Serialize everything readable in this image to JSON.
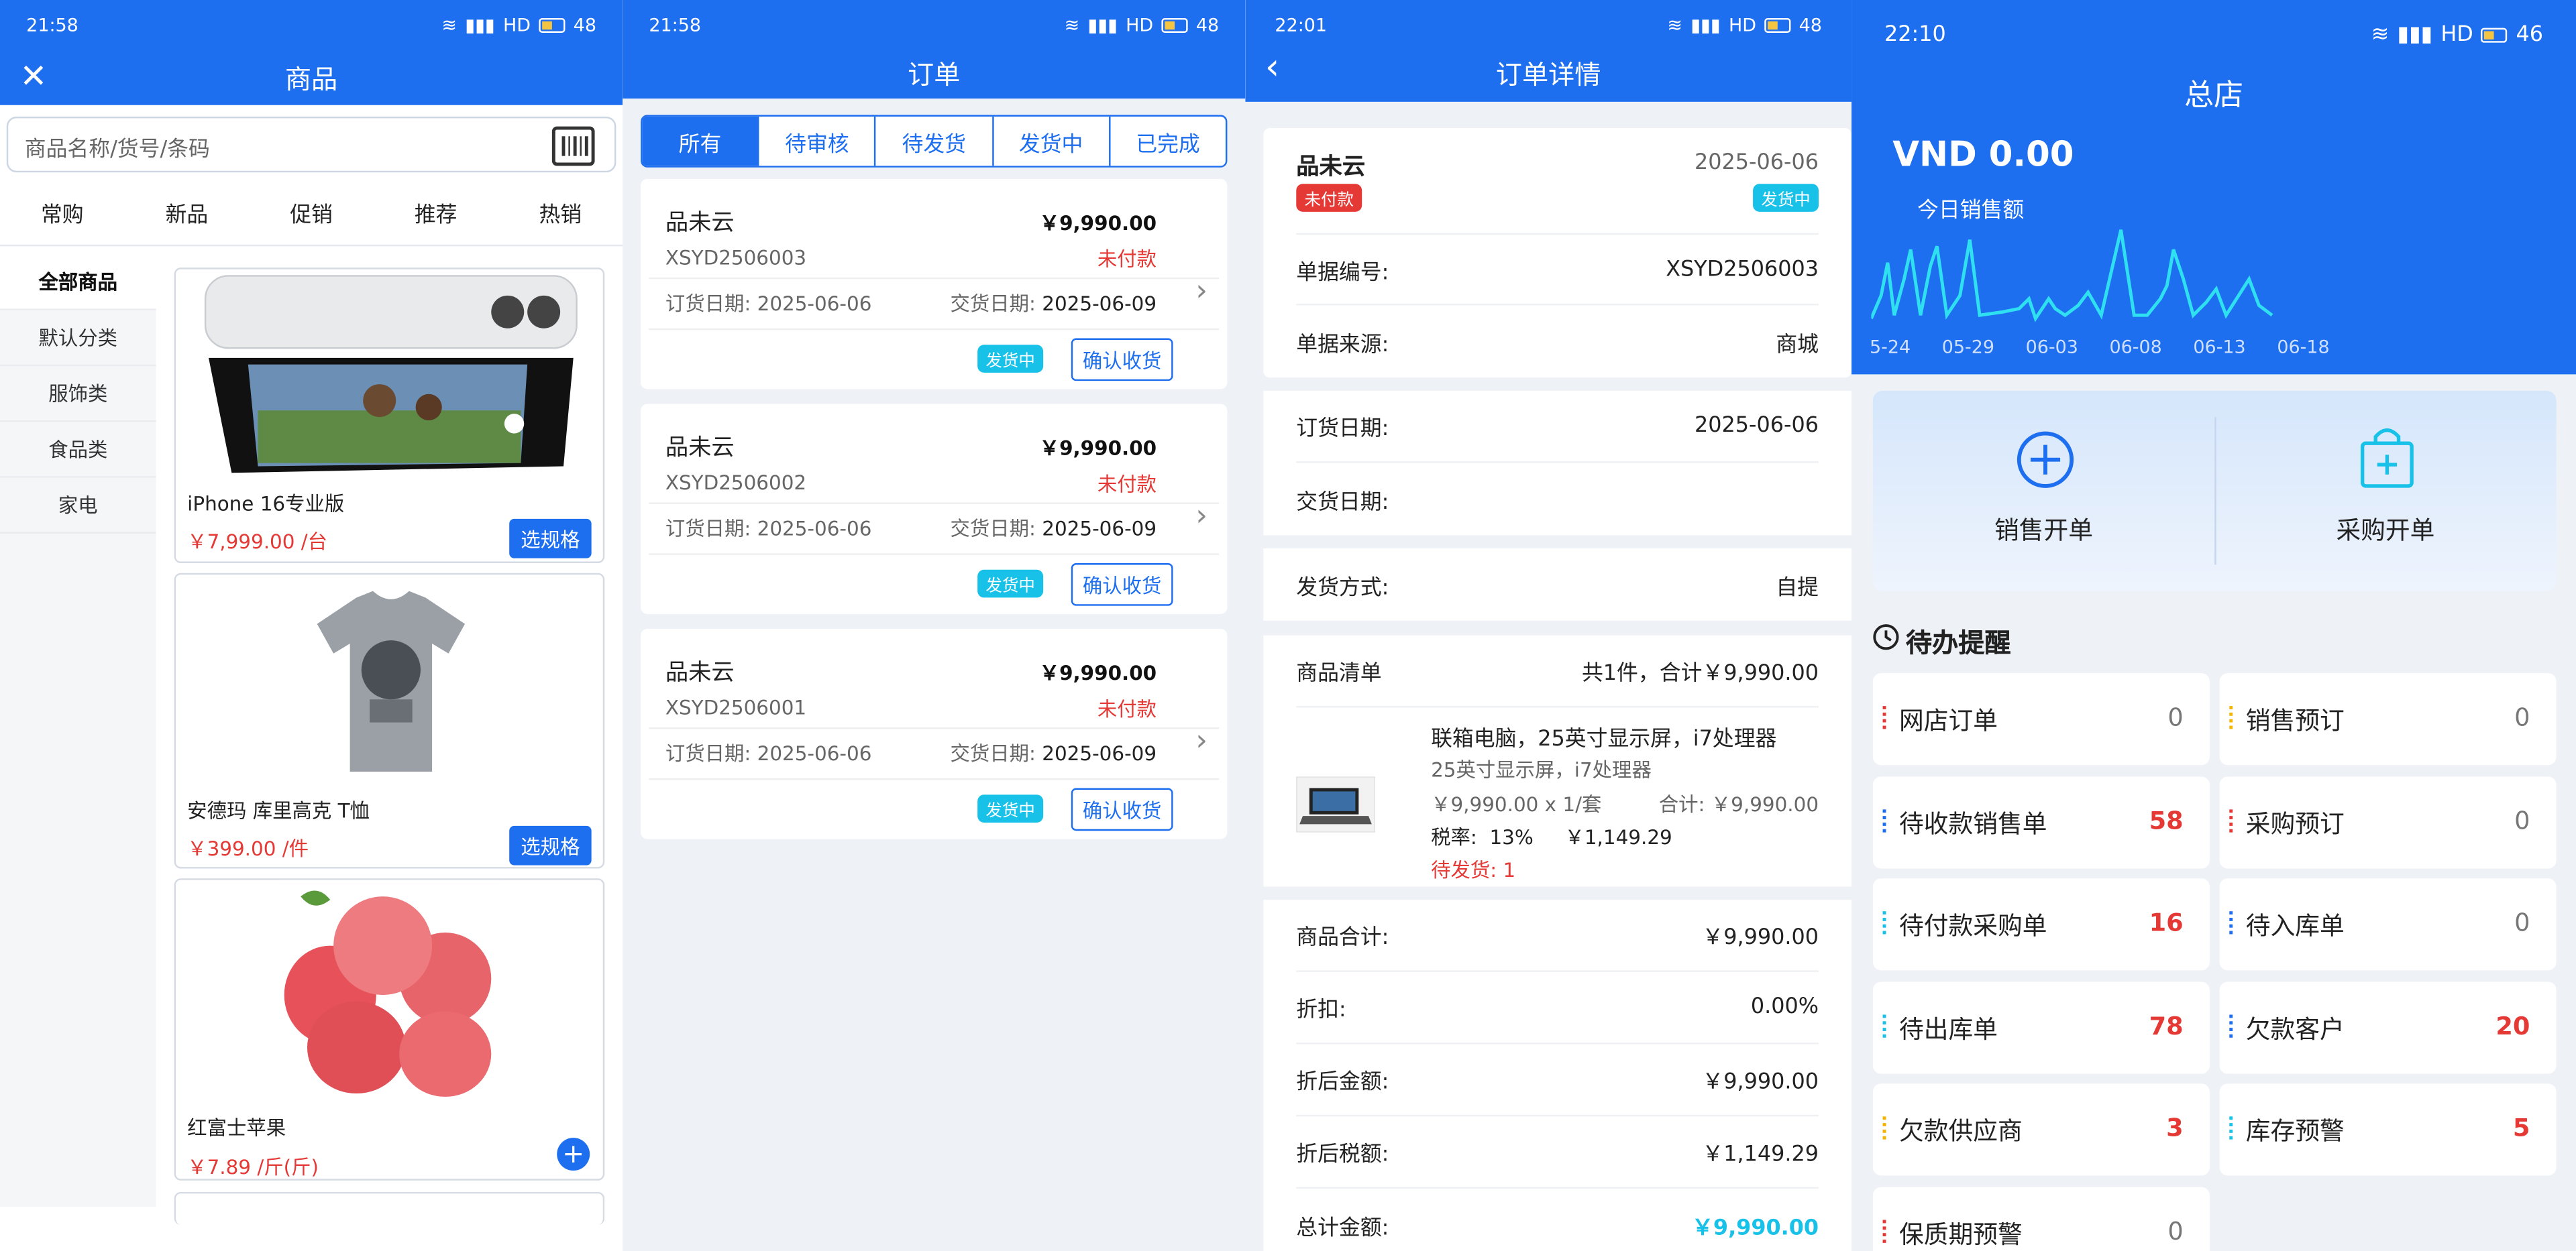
{
  "status_bar": [
    {
      "time": "21:58",
      "indicators": "HD",
      "battery": "48"
    },
    {
      "time": "21:58",
      "indicators": "HD",
      "battery": "48"
    },
    {
      "time": "22:01",
      "indicators": "HD",
      "battery": "48"
    },
    {
      "time": "22:10",
      "indicators": "HD",
      "battery": "46"
    }
  ],
  "colors": {
    "brand": "#1e6ff0",
    "price": "#e53935",
    "badge": "#17c1e8"
  },
  "products": {
    "title": "商品",
    "search_placeholder": "商品名称/货号/条码",
    "tabs": [
      "常购",
      "新品",
      "促销",
      "推荐",
      "热销"
    ],
    "categories": [
      "全部商品",
      "默认分类",
      "服饰类",
      "食品类",
      "家电"
    ],
    "items": [
      {
        "name": "iPhone 16专业版",
        "price": "￥7,999.00 /台",
        "action": "选规格"
      },
      {
        "name": "安德玛 库里高克 T恤",
        "price": "￥399.00 /件",
        "action": "选规格"
      },
      {
        "name": "红富士苹果",
        "price": "￥7.89 /斤(斤)",
        "action": "+"
      }
    ]
  },
  "orders": {
    "title": "订单",
    "tabs": [
      "所有",
      "待审核",
      "待发货",
      "发货中",
      "已完成"
    ],
    "list": [
      {
        "shop": "品未云",
        "amount": "￥9,990.00",
        "no": "XSYD2506003",
        "status": "未付款",
        "order_date": "订货日期: 2025-06-06",
        "deliver_label": "交货日期: ",
        "deliver_date": "2025-06-09",
        "badge": "发货中",
        "action": "确认收货"
      },
      {
        "shop": "品未云",
        "amount": "￥9,990.00",
        "no": "XSYD2506002",
        "status": "未付款",
        "order_date": "订货日期: 2025-06-06",
        "deliver_label": "交货日期: ",
        "deliver_date": "2025-06-09",
        "badge": "发货中",
        "action": "确认收货"
      },
      {
        "shop": "品未云",
        "amount": "￥9,990.00",
        "no": "XSYD2506001",
        "status": "未付款",
        "order_date": "订货日期: 2025-06-06",
        "deliver_label": "交货日期: ",
        "deliver_date": "2025-06-09",
        "badge": "发货中",
        "action": "确认收货"
      }
    ]
  },
  "detail": {
    "title": "订单详情",
    "shop": "品未云",
    "pay_badge": "未付款",
    "date": "2025-06-06",
    "ship_badge": "发货中",
    "doc_no_label": "单据编号:",
    "doc_no": "XSYD2506003",
    "source_label": "单据来源:",
    "source": "商城",
    "order_date_label": "订货日期:",
    "order_date": "2025-06-06",
    "deliver_date_label": "交货日期:",
    "ship_method_label": "发货方式:",
    "ship_method": "自提",
    "list_label": "商品清单",
    "list_summary": "共1件，合计￥9,990.00",
    "item_name": "联箱电脑，25英寸显示屏，i7处理器",
    "item_spec": "25英寸显示屏，i7处理器",
    "item_qty": "￥9,990.00 x 1/套",
    "item_total": "合计: ￥9,990.00",
    "item_tax": "税率:  13%     ￥1,149.29",
    "item_pending": "待发货: 1",
    "sub_label": "商品合计:",
    "sub": "￥9,990.00",
    "disc_label": "折扣:",
    "disc": "0.00%",
    "after_label": "折后金额:",
    "after": "￥9,990.00",
    "tax_label": "折后税额:",
    "tax": "￥1,149.29",
    "total_label": "总计金额:",
    "total": "￥9,990.00"
  },
  "home": {
    "title": "总店",
    "sales": "VND 0.00",
    "sales_label": "今日销售额",
    "chart_data": {
      "type": "line",
      "x_ticks": [
        "5-24",
        "05-29",
        "06-03",
        "06-08",
        "06-13",
        "06-18"
      ],
      "note": "daily sales sparkline, unlabeled y values"
    },
    "actions": [
      "销售开单",
      "采购开单"
    ],
    "pending_title": "待办提醒",
    "pending": [
      {
        "label": "网店订单",
        "count": "0",
        "color": "#e53935",
        "hot": false
      },
      {
        "label": "销售预订",
        "count": "0",
        "color": "#f5b400",
        "hot": false
      },
      {
        "label": "待收款销售单",
        "count": "58",
        "color": "#1e6ff0",
        "hot": true
      },
      {
        "label": "采购预订",
        "count": "0",
        "color": "#e53935",
        "hot": false
      },
      {
        "label": "待付款采购单",
        "count": "16",
        "color": "#17c1e8",
        "hot": true
      },
      {
        "label": "待入库单",
        "count": "0",
        "color": "#1e6ff0",
        "hot": false
      },
      {
        "label": "待出库单",
        "count": "78",
        "color": "#17c1e8",
        "hot": true
      },
      {
        "label": "欠款客户",
        "count": "20",
        "color": "#1e6ff0",
        "hot": true
      },
      {
        "label": "欠款供应商",
        "count": "3",
        "color": "#f5b400",
        "hot": true
      },
      {
        "label": "库存预警",
        "count": "5",
        "color": "#17c1e8",
        "hot": true
      },
      {
        "label": "保质期预警",
        "count": "0",
        "color": "#e53935",
        "hot": false
      }
    ]
  }
}
